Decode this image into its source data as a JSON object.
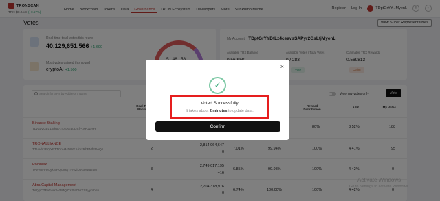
{
  "header": {
    "logo_text": "TRONSCAN",
    "trx_price": "TRX: $0.2448",
    "trx_change": "(+0.57%)",
    "nav": [
      "Home",
      "Blockchain",
      "Tokens",
      "Data",
      "Governance",
      "TRON Ecosystem",
      "Developers",
      "More",
      "SunPump Meme"
    ],
    "active_nav": "Governance",
    "register": "Register",
    "login": "Log In",
    "account_short": "TDptGrYY...MyenL"
  },
  "page": {
    "title": "Votes",
    "super_reps_button": "View Super Representatives"
  },
  "stats": {
    "realtime_label": "Real-time total votes this round",
    "realtime_value": "40,129,651,566",
    "realtime_delta": "+1,690",
    "most_votes_label": "Most votes gained this round",
    "most_votes_name": "cryptoAI",
    "most_votes_delta": "+1,500",
    "countdown": [
      "5",
      "48",
      "58"
    ]
  },
  "account": {
    "label": "My Account",
    "address": "TDptGrYYDtLz4ceavsSAPyr2GsLtjMyenL",
    "available_balance_label": "Available TRX Balance",
    "available_balance_value": "0.569930",
    "available_votes_label": "Available Votes / Total Votes",
    "available_votes_value": "0 / 283",
    "claimable_label": "Claimable TRX Rewards",
    "claimable_value": "0.569813",
    "vote_button": "Vote",
    "claim_button": "Claim"
  },
  "toolbar": {
    "search_placeholder": "Search for SRs by Address / Name",
    "view_my_votes": "View my votes only",
    "vote_button": "Vote"
  },
  "table": {
    "headers": {
      "realtime_rank": "Real-Time Ranking",
      "reward": "Reward Distribution",
      "apr": "APR",
      "my_votes": "My Votes"
    },
    "rows": [
      {
        "name": "Binance Staking",
        "address": "TLyqzVGLV1srkB7tToTAEqgDSfPtXRJZYH",
        "rank": "",
        "votes": "",
        "votes_delta": "",
        "percent": "",
        "productivity": "",
        "reward": "80%",
        "apr": "3.52%",
        "my_votes": "188"
      },
      {
        "name": "TRONALLIANCE",
        "address": "TTVwbi3EQYFTTCnHMDWKAfmxRhPMf2DeQ1",
        "rank": "2",
        "votes": "2,814,964,647",
        "votes_delta": "0",
        "percent": "7.01%",
        "productivity": "99.94%",
        "reward": "100%",
        "apr": "4.41%",
        "my_votes": "95"
      },
      {
        "name": "Poloniex",
        "address": "TAvHnFFHLykt9RQcVxyTFN2iDvGHuuD4M",
        "rank": "3",
        "votes": "2,749,017,195",
        "votes_delta": "+16",
        "percent": "6.85%",
        "productivity": "99.98%",
        "reward": "100%",
        "apr": "4.42%",
        "my_votes": "0"
      },
      {
        "name": "Abra Capital Management",
        "address": "TAQpCTFeJvwdWdMQZtXf0LtWrTS9yymbhb",
        "rank": "4",
        "votes": "2,704,318,976",
        "votes_delta": "0",
        "percent": "6.74%",
        "productivity": "100.00%",
        "reward": "100%",
        "apr": "4.42%",
        "my_votes": "0"
      }
    ]
  },
  "watermark": {
    "line1": "Activate Windows",
    "line2": "Go to Settings to activate Windows."
  },
  "modal": {
    "title": "Voted Successfully",
    "sub_before": "It takes about",
    "sub_bold": "2 minutes",
    "sub_after": "to update data.",
    "confirm": "Confirm",
    "close": "×",
    "check": "✓"
  }
}
